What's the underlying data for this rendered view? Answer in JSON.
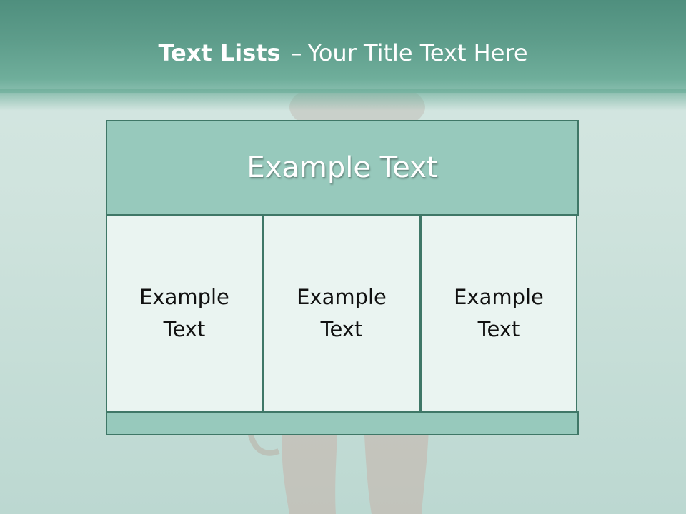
{
  "title": {
    "bold": "Text Lists",
    "dash": "–",
    "rest": "Your Title Text Here"
  },
  "diagram": {
    "header": "Example Text",
    "columns": [
      "Example Text",
      "Example Text",
      "Example Text"
    ]
  },
  "colors": {
    "title_bar": "#5e9d8b",
    "box_fill": "#97c9bc",
    "cell_fill": "#eaf4f1",
    "border": "#3f7767",
    "title_text": "#ffffff"
  }
}
